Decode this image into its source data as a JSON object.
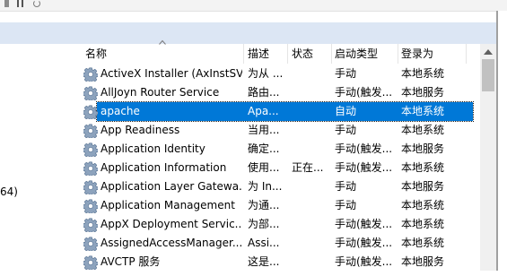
{
  "left_pane": {
    "partial_text": "64)"
  },
  "columns": {
    "name": "名称",
    "description": "描述",
    "status": "状态",
    "startup_type": "启动类型",
    "log_on_as": "登录为"
  },
  "services": [
    {
      "name": "ActiveX Installer (AxInstSV)",
      "description": "为从 ...",
      "status": "",
      "startup_type": "手动",
      "log_on_as": "本地系统"
    },
    {
      "name": "AllJoyn Router Service",
      "description": "路由...",
      "status": "",
      "startup_type": "手动(触发...",
      "log_on_as": "本地服务"
    },
    {
      "name": "apache",
      "description": "Apa...",
      "status": "",
      "startup_type": "自动",
      "log_on_as": "本地系统",
      "selected": true
    },
    {
      "name": "App Readiness",
      "description": "当用...",
      "status": "",
      "startup_type": "手动",
      "log_on_as": "本地系统"
    },
    {
      "name": "Application Identity",
      "description": "确定...",
      "status": "",
      "startup_type": "手动(触发...",
      "log_on_as": "本地服务"
    },
    {
      "name": "Application Information",
      "description": "使用...",
      "status": "正在...",
      "startup_type": "手动(触发...",
      "log_on_as": "本地系统"
    },
    {
      "name": "Application Layer Gatewa...",
      "description": "为 In...",
      "status": "",
      "startup_type": "手动",
      "log_on_as": "本地服务"
    },
    {
      "name": "Application Management",
      "description": "为通...",
      "status": "",
      "startup_type": "手动",
      "log_on_as": "本地系统"
    },
    {
      "name": "AppX Deployment Servic...",
      "description": "为部...",
      "status": "",
      "startup_type": "手动(触发...",
      "log_on_as": "本地系统"
    },
    {
      "name": "AssignedAccessManager...",
      "description": "Assi...",
      "status": "",
      "startup_type": "手动(触发...",
      "log_on_as": "本地系统"
    },
    {
      "name": "AVCTP 服务",
      "description": "这是...",
      "status": "",
      "startup_type": "手动(触发...",
      "log_on_as": "本地服务"
    }
  ],
  "colors": {
    "selection": "#0078d7",
    "header_band": "#dce6f4"
  },
  "icons": {
    "service": "gear-icon",
    "sort": "sort-ascending-icon"
  }
}
